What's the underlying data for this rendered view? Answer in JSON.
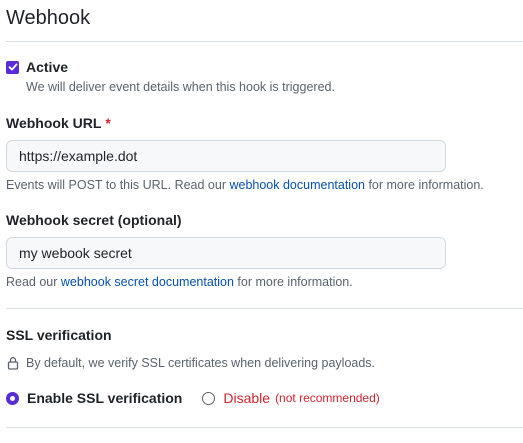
{
  "header": {
    "title": "Webhook"
  },
  "active": {
    "label": "Active",
    "checked": true,
    "description": "We will deliver event details when this hook is triggered."
  },
  "url": {
    "label": "Webhook URL",
    "required_marker": "*",
    "value": "https://example.dot",
    "help_before": "Events will POST to this URL. Read our ",
    "help_link": "webhook documentation",
    "help_after": " for more information."
  },
  "secret": {
    "label": "Webhook secret (optional)",
    "value": "my webook secret",
    "help_before": "Read our ",
    "help_link": "webhook secret documentation",
    "help_after": " for more information."
  },
  "ssl": {
    "title": "SSL verification",
    "description": "By default, we verify SSL certificates when delivering payloads.",
    "enable_label": "Enable SSL verification",
    "disable_label": "Disable",
    "disable_note": "(not recommended)",
    "selected": "enable",
    "lock_icon": "lock-icon"
  },
  "colors": {
    "accent": "#5a2cd8",
    "link": "#0550ae",
    "danger": "#d1242f"
  }
}
